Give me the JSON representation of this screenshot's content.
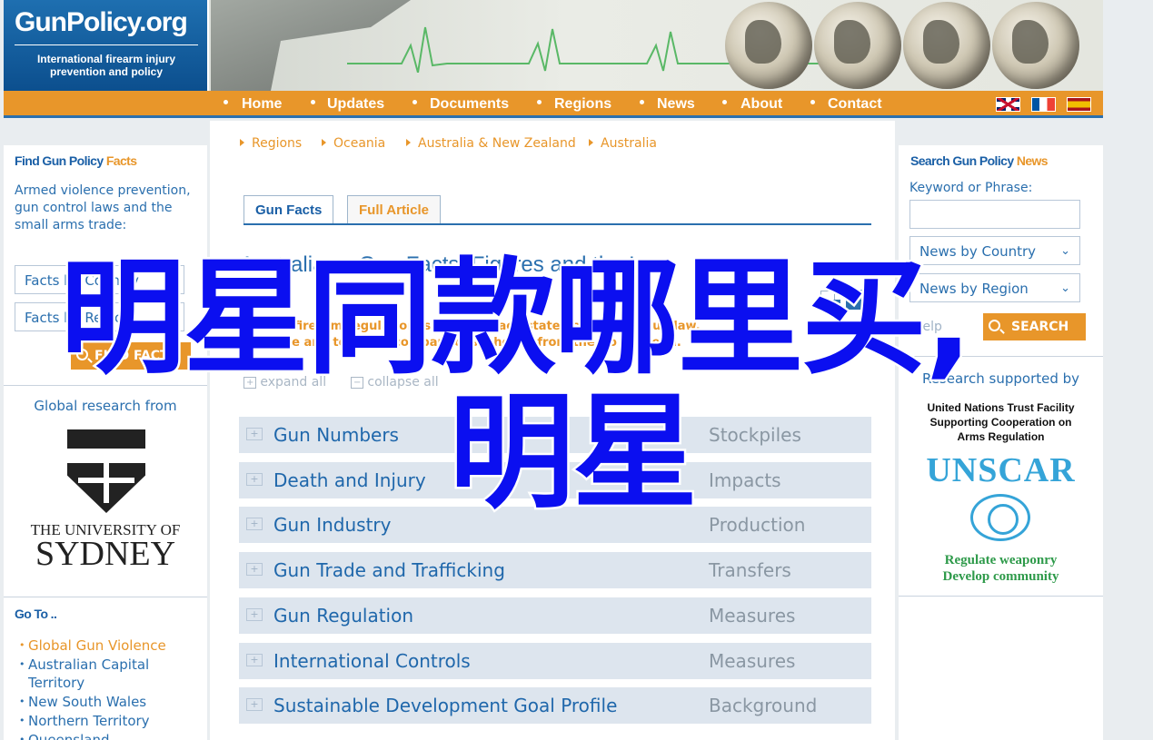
{
  "logo": {
    "title": "GunPolicy.org",
    "subtitle_line1": "International firearm injury",
    "subtitle_line2": "prevention and policy"
  },
  "nav": {
    "items": [
      "Home",
      "Updates",
      "Documents",
      "Regions",
      "News",
      "About",
      "Contact"
    ],
    "flags": [
      "uk-flag-icon",
      "france-flag-icon",
      "spain-flag-icon"
    ]
  },
  "left": {
    "find_title_a": "Find Gun Policy ",
    "find_title_b": "Facts",
    "intro": "Armed violence prevention, gun control laws and the small arms trade:",
    "facts_country": "Facts by Country",
    "facts_region": "Facts by Region",
    "find_button": "FIND FACTS",
    "research_from": "Global research from",
    "uni_line1": "THE UNIVERSITY OF",
    "uni_line2": "SYDNEY",
    "goto_title": "Go To ..",
    "goto_items": [
      "Global Gun Violence",
      "Australian Capital Territory",
      "New South Wales",
      "Northern Territory",
      "Queensland"
    ]
  },
  "center": {
    "breadcrumb": [
      "Regions",
      "Oceania",
      "Australia & New Zealand",
      "Australia"
    ],
    "tabs": [
      "Gun Facts",
      "Full Article"
    ],
    "title": "Australia — Gun Facts, Figures and the Law",
    "summary_line1": "Federal firearm regulation is limited; each state has its own gun law.",
    "summary_line2": "For state and territory comparisons, choose from the Go To menu.",
    "expand_all": "expand all",
    "collapse_all": "collapse all",
    "topics": [
      {
        "name": "Gun Numbers",
        "category": "Stockpiles"
      },
      {
        "name": "Death and Injury",
        "category": "Impacts"
      },
      {
        "name": "Gun Industry",
        "category": "Production"
      },
      {
        "name": "Gun Trade and Trafficking",
        "category": "Transfers"
      },
      {
        "name": "Gun Regulation",
        "category": "Measures"
      },
      {
        "name": "International Controls",
        "category": "Measures"
      },
      {
        "name": "Sustainable Development Goal Profile",
        "category": "Background"
      }
    ]
  },
  "right": {
    "title_a": "Search Gun Policy ",
    "title_b": "News",
    "keyword_label": "Keyword or Phrase:",
    "keyword_value": "",
    "country_select": "News by Country",
    "region_select": "News by Region",
    "help": "Help",
    "search_button": "SEARCH",
    "supported_by": "Research supported by",
    "un_line1": "United Nations Trust Facility",
    "un_line2": "Supporting Cooperation on",
    "un_line3": "Arms Regulation",
    "unscar": "UNSCAR",
    "motto1": "Regulate weaponry",
    "motto2": "Develop community"
  },
  "overlay": {
    "line1": "明星同款哪里买,",
    "line2": "明星"
  },
  "colors": {
    "nav_orange": "#e8962a",
    "brand_blue": "#1a5fa6",
    "overlay_blue": "#0b0ff0"
  }
}
